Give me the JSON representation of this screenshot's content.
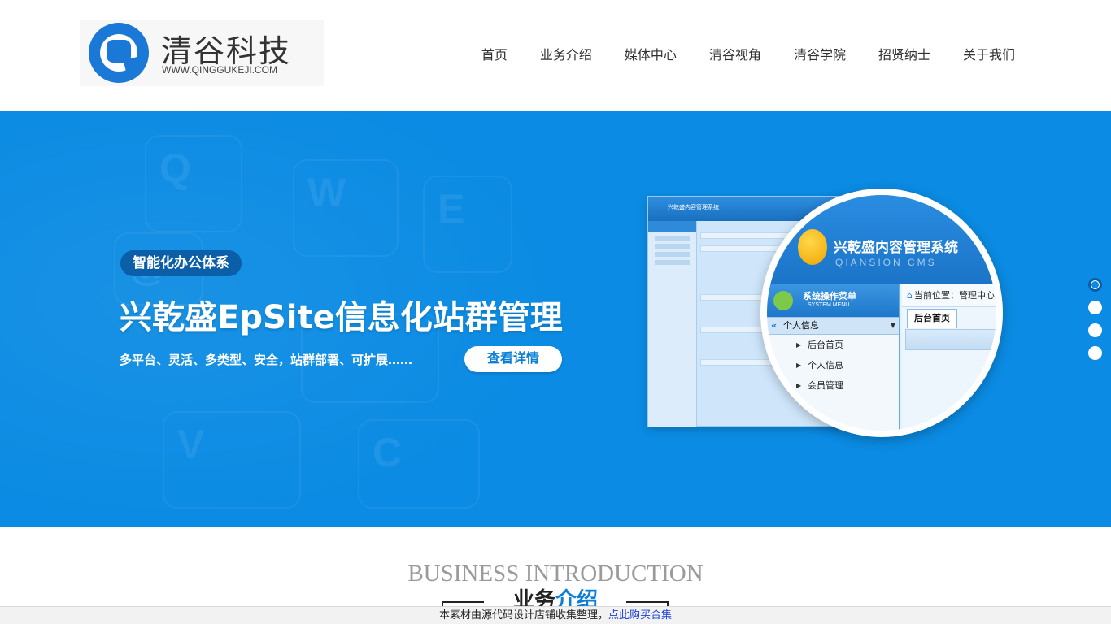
{
  "header": {
    "logo_title": "清谷科技",
    "logo_url_text": "WWW.QINGGUKEJI.COM",
    "nav": [
      {
        "label": "首页"
      },
      {
        "label": "业务介绍"
      },
      {
        "label": "媒体中心"
      },
      {
        "label": "清谷视角"
      },
      {
        "label": "清谷学院"
      },
      {
        "label": "招贤纳士"
      },
      {
        "label": "关于我们"
      }
    ]
  },
  "banner": {
    "tag": "智能化办公体系",
    "headline": "兴乾盛EpSite信息化站群管理",
    "description": "多平台、灵活、多类型、安全，站群部署、可扩展……",
    "button": "查看详情",
    "background_color": "#0b8be3",
    "mock": {
      "title": "兴乾盛内容管理系统",
      "subtitle": "QIANSION CMS",
      "menu_title": "系统操作菜单",
      "menu_sub": "SYSTEM MENU",
      "group": "个人信息",
      "items": [
        "后台首页",
        "个人信息",
        "会员管理"
      ],
      "breadcrumb": "当前位置：管理中心",
      "tab": "后台首页"
    },
    "slides": {
      "count": 4,
      "active_index": 0
    }
  },
  "business": {
    "title_en": "BUSINESS INTRODUCTION",
    "title_cn_dark": "业务",
    "title_cn_accent": "介绍",
    "accent_color": "#0b7fd6"
  },
  "notice": {
    "text": "本素材由源代码设计店铺收集整理，",
    "link": "点此购买合集"
  }
}
